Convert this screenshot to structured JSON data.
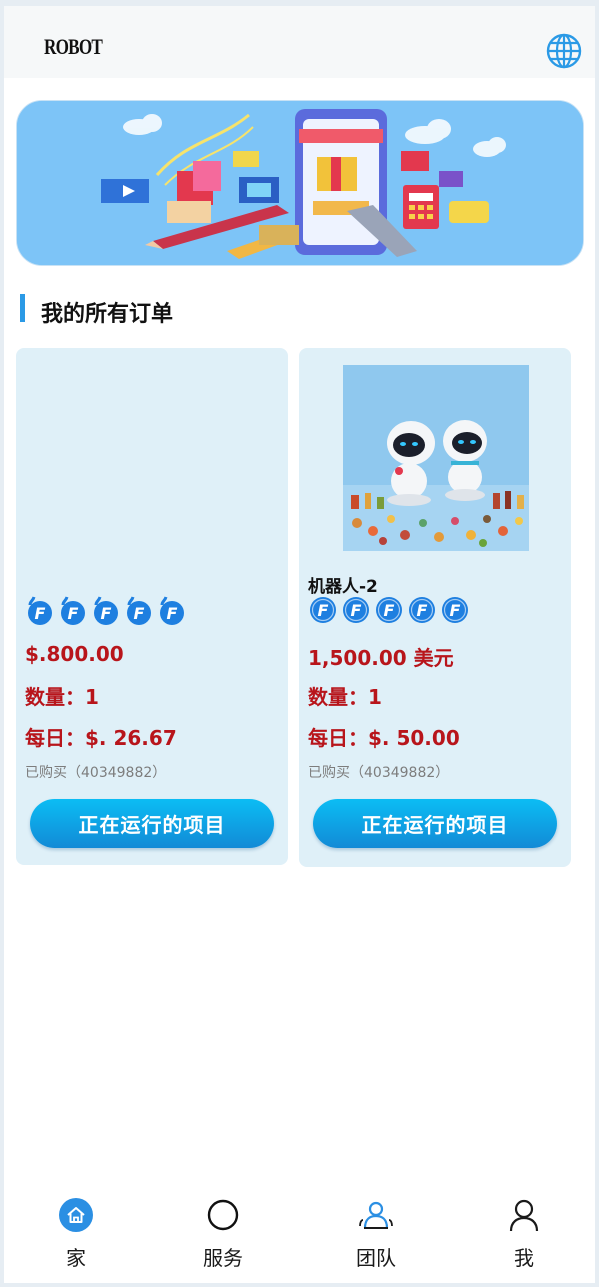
{
  "header": {
    "logo_text": "ROBOT",
    "language_icon": "globe-icon"
  },
  "section": {
    "title": "我的所有订单"
  },
  "orders": [
    {
      "name": "",
      "image": "blank",
      "stars": 5,
      "star_icon": "badge-f-icon",
      "price": "$.800.00",
      "quantity": "数量：1",
      "daily": "每日：$. 26.67",
      "purchased": "已购买（40349882）",
      "button_label": "正在运行的项目"
    },
    {
      "name": "机器人-2",
      "image": "robots-with-snacks",
      "stars": 5,
      "star_icon": "badge-f-icon",
      "price": "1,500.00 美元",
      "quantity": "数量：1",
      "daily": "每日：$. 50.00",
      "purchased": "已购买（40349882）",
      "button_label": "正在运行的项目"
    }
  ],
  "tabbar": {
    "items": [
      {
        "label": "家",
        "icon": "home-icon",
        "active": true
      },
      {
        "label": "服务",
        "icon": "circle-icon",
        "active": false
      },
      {
        "label": "团队",
        "icon": "team-icon",
        "active": false
      },
      {
        "label": "我",
        "icon": "person-icon",
        "active": false
      }
    ]
  },
  "colors": {
    "accent": "#2b9ae6",
    "price_red": "#b8151b",
    "card_bg": "#dff0f8",
    "banner_bg": "#7dc4f7"
  }
}
